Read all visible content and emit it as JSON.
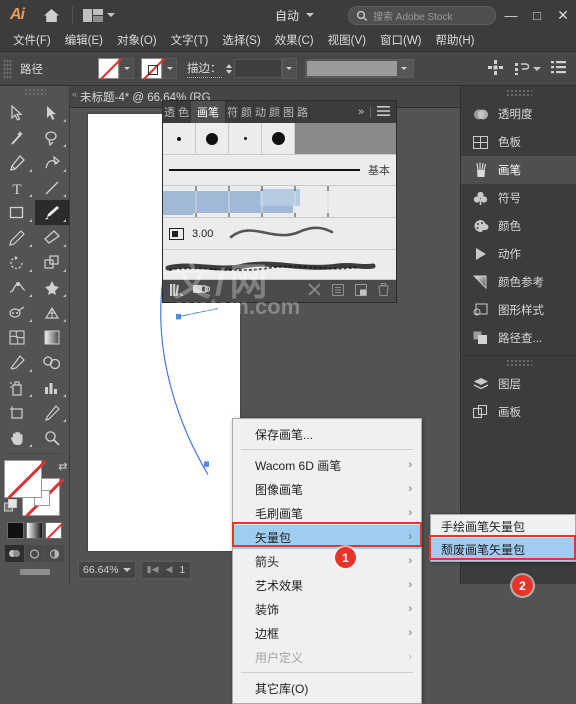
{
  "app": {
    "logo": "Ai",
    "home_icon": "home-icon",
    "arrange_icon": "arrange-documents-icon",
    "auto_label": "自动",
    "search_placeholder": "搜索 Adobe Stock",
    "search_icon": "search-icon",
    "window_controls": {
      "minimize": "—",
      "maximize": "□",
      "close": "✕"
    }
  },
  "menubar": {
    "items": [
      {
        "label": "文件(F)"
      },
      {
        "label": "编辑(E)"
      },
      {
        "label": "对象(O)"
      },
      {
        "label": "文字(T)"
      },
      {
        "label": "选择(S)"
      },
      {
        "label": "效果(C)"
      },
      {
        "label": "视图(V)"
      },
      {
        "label": "窗口(W)"
      },
      {
        "label": "帮助(H)"
      }
    ]
  },
  "controlbar": {
    "context_label": "路径",
    "fill_swatch": "none-fill-swatch",
    "stroke_swatch": "none-stroke-swatch",
    "stroke_label": "描边：",
    "stroke_weight_value": "",
    "profile_value": "",
    "align_icon": "align-icon",
    "transform_icon": "transform-icon",
    "options_icon": "options-menu-icon"
  },
  "toolbar": {
    "tools": [
      {
        "name": "selection-tool",
        "glyph": "arrow-outline"
      },
      {
        "name": "direct-selection-tool",
        "glyph": "arrow-solid"
      },
      {
        "name": "magic-wand-tool",
        "glyph": "wand"
      },
      {
        "name": "lasso-tool",
        "glyph": "lasso"
      },
      {
        "name": "pen-tool",
        "glyph": "pen"
      },
      {
        "name": "curvature-tool",
        "glyph": "curvature"
      },
      {
        "name": "type-tool",
        "glyph": "T"
      },
      {
        "name": "line-segment-tool",
        "glyph": "line"
      },
      {
        "name": "rectangle-tool",
        "glyph": "rect"
      },
      {
        "name": "paintbrush-tool",
        "glyph": "brush",
        "active": true
      },
      {
        "name": "pencil-tool",
        "glyph": "pencil"
      },
      {
        "name": "eraser-tool",
        "glyph": "eraser"
      },
      {
        "name": "rotate-tool",
        "glyph": "rotate"
      },
      {
        "name": "shape-builder-tool",
        "glyph": "shapebuilder"
      },
      {
        "name": "width-tool",
        "glyph": "width"
      },
      {
        "name": "free-transform-tool",
        "glyph": "freetransform"
      },
      {
        "name": "puppet-warp-tool",
        "glyph": "puppet"
      },
      {
        "name": "perspective-grid-tool",
        "glyph": "perspective"
      },
      {
        "name": "mesh-tool",
        "glyph": "mesh"
      },
      {
        "name": "gradient-tool",
        "glyph": "gradient"
      },
      {
        "name": "eyedropper-tool",
        "glyph": "eyedropper"
      },
      {
        "name": "blend-tool",
        "glyph": "blend"
      },
      {
        "name": "symbol-sprayer-tool",
        "glyph": "sprayer"
      },
      {
        "name": "column-graph-tool",
        "glyph": "graph"
      },
      {
        "name": "artboard-tool",
        "glyph": "artboard"
      },
      {
        "name": "slice-tool",
        "glyph": "slice"
      },
      {
        "name": "hand-tool",
        "glyph": "hand"
      },
      {
        "name": "zoom-tool",
        "glyph": "zoom"
      }
    ],
    "fill_label": "fill-none",
    "stroke_label": "stroke-none",
    "swap_icon": "swap-fill-stroke-icon",
    "default_icon": "default-fill-stroke-icon",
    "color_modes": [
      {
        "name": "color-mode-color",
        "label": ""
      },
      {
        "name": "color-mode-gradient",
        "label": ""
      },
      {
        "name": "color-mode-none",
        "label": ""
      }
    ],
    "screen_modes": [
      {
        "name": "screen-mode-normal",
        "active": true
      },
      {
        "name": "screen-mode-fullscreen-menu",
        "active": false
      },
      {
        "name": "screen-mode-fullscreen",
        "active": false
      }
    ]
  },
  "document": {
    "tab_title": "未标题-4* @ 66.64% (RG",
    "zoom_level": "66.64%",
    "page_number": "1"
  },
  "brush_panel": {
    "tabs": [
      {
        "label": "透",
        "active": false
      },
      {
        "label": "色",
        "active": false
      },
      {
        "label": "画笔",
        "active": true
      },
      {
        "label": "符",
        "active": false
      },
      {
        "label": "颜",
        "active": false
      },
      {
        "label": "动",
        "active": false
      },
      {
        "label": "颜",
        "active": false
      },
      {
        "label": "图",
        "active": false
      },
      {
        "label": "路",
        "active": false
      }
    ],
    "overflow_icon": "overflow-chevrons-icon",
    "menu_icon": "panel-menu-icon",
    "basic_label": "基本",
    "size_value": "3.00",
    "footer": {
      "libraries_icon": "brush-libraries-icon",
      "options_icon": "brush-options-icon",
      "remove_link_icon": "remove-brush-stroke-icon",
      "options_panel_icon": "brush-options-panel-icon",
      "new_brush_icon": "new-brush-icon",
      "delete_icon": "delete-brush-icon"
    },
    "watermark_line1": "文/网",
    "watermark_line2": "system.com"
  },
  "dock": {
    "items": [
      {
        "label": "透明度",
        "icon": "transparency-icon",
        "active": false
      },
      {
        "label": "色板",
        "icon": "swatches-icon",
        "active": false
      },
      {
        "label": "画笔",
        "icon": "brushes-icon",
        "active": true
      },
      {
        "label": "符号",
        "icon": "symbols-icon",
        "active": false
      },
      {
        "label": "颜色",
        "icon": "color-icon",
        "active": false
      },
      {
        "label": "动作",
        "icon": "actions-icon",
        "active": false
      },
      {
        "label": "颜色参考",
        "icon": "color-guide-icon",
        "active": false
      },
      {
        "label": "图形样式",
        "icon": "graphic-styles-icon",
        "active": false
      },
      {
        "label": "路径查...",
        "icon": "pathfinder-icon",
        "active": false
      }
    ],
    "items2": [
      {
        "label": "图层",
        "icon": "layers-icon",
        "active": false
      },
      {
        "label": "画板",
        "icon": "artboards-icon",
        "active": false
      }
    ]
  },
  "context_menu": {
    "items": [
      {
        "label": "保存画笔...",
        "submenu": false,
        "selected": false,
        "disabled": false,
        "separator_after": true
      },
      {
        "label": "Wacom 6D 画笔",
        "submenu": true,
        "selected": false,
        "disabled": false
      },
      {
        "label": "图像画笔",
        "submenu": true,
        "selected": false,
        "disabled": false
      },
      {
        "label": "毛刷画笔",
        "submenu": true,
        "selected": false,
        "disabled": false
      },
      {
        "label": "矢量包",
        "submenu": true,
        "selected": true,
        "disabled": false
      },
      {
        "label": "箭头",
        "submenu": true,
        "selected": false,
        "disabled": false
      },
      {
        "label": "艺术效果",
        "submenu": true,
        "selected": false,
        "disabled": false
      },
      {
        "label": "装饰",
        "submenu": true,
        "selected": false,
        "disabled": false
      },
      {
        "label": "边框",
        "submenu": true,
        "selected": false,
        "disabled": false
      },
      {
        "label": "用户定义",
        "submenu": true,
        "selected": false,
        "disabled": true,
        "separator_after": true
      },
      {
        "label": "其它库(O)",
        "submenu": false,
        "selected": false,
        "disabled": false
      }
    ]
  },
  "submenu": {
    "items": [
      {
        "label": "手绘画笔矢量包",
        "selected": false
      },
      {
        "label": "颓废画笔矢量包",
        "selected": true
      }
    ]
  },
  "annotations": {
    "badge1": "1",
    "badge2": "2",
    "highlight_color": "#e8352a"
  }
}
